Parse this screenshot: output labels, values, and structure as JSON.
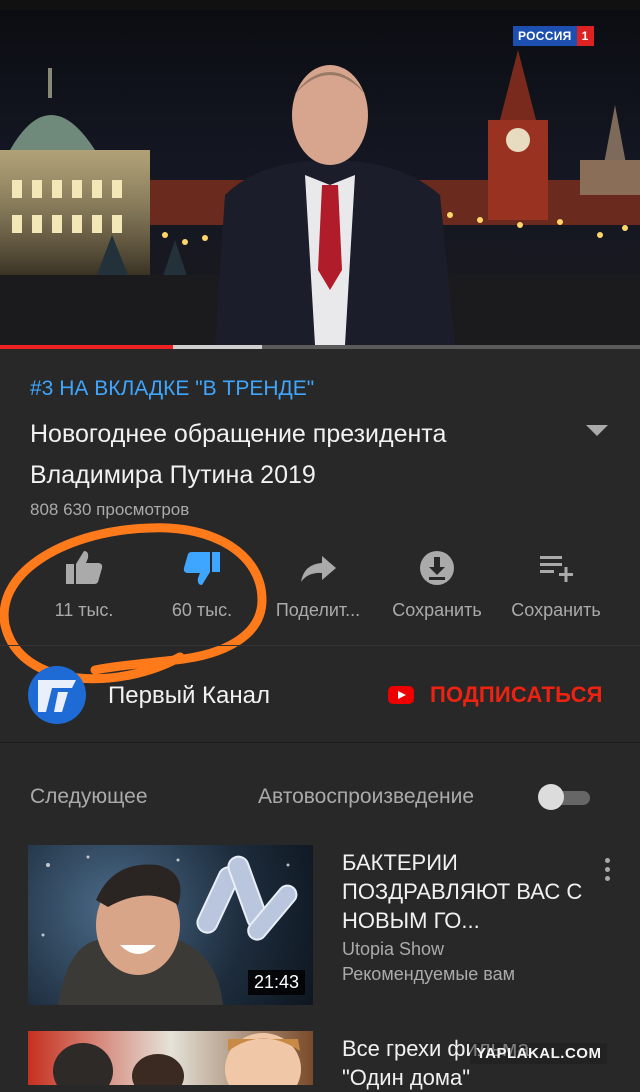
{
  "video": {
    "channel_logo_name": "РОССИЯ",
    "channel_logo_number": "1",
    "progress_played": 0.27,
    "progress_buffered": 0.41
  },
  "info": {
    "trending": "#3 НА ВКЛАДКЕ \"В ТРЕНДЕ\"",
    "title": "Новогоднее обращение президента Владимира Путина 2019",
    "views": "808 630 просмотров"
  },
  "actions": [
    {
      "label": "11 тыс.",
      "icon": "thumbs-up-icon"
    },
    {
      "label": "60 тыс.",
      "icon": "thumbs-down-icon",
      "color": "#3ea6ff"
    },
    {
      "label": "Поделит...",
      "icon": "share-icon"
    },
    {
      "label": "Сохранить",
      "icon": "download-icon"
    },
    {
      "label": "Сохранить",
      "icon": "add-to-playlist-icon"
    }
  ],
  "channel": {
    "name": "Первый Канал",
    "subscribe": "ПОДПИСАТЬСЯ"
  },
  "upnext": {
    "label": "Следующее",
    "autoplay_label": "Автовоспроизведение",
    "autoplay_on": false
  },
  "videos": [
    {
      "title": "БАКТЕРИИ ПОЗДРАВЛЯЮТ ВАС С НОВЫМ ГО...",
      "channel": "Utopia Show",
      "meta": "Рекомендуемые вам",
      "duration": "21:43"
    },
    {
      "title": "Все грехи фильма \"Один дома\""
    }
  ],
  "watermark": "YAPLAKAL.COM",
  "colors": {
    "accent_blue": "#3ea6ff",
    "subscribe_red": "#e21",
    "annotation_orange": "#ff7a1a"
  }
}
